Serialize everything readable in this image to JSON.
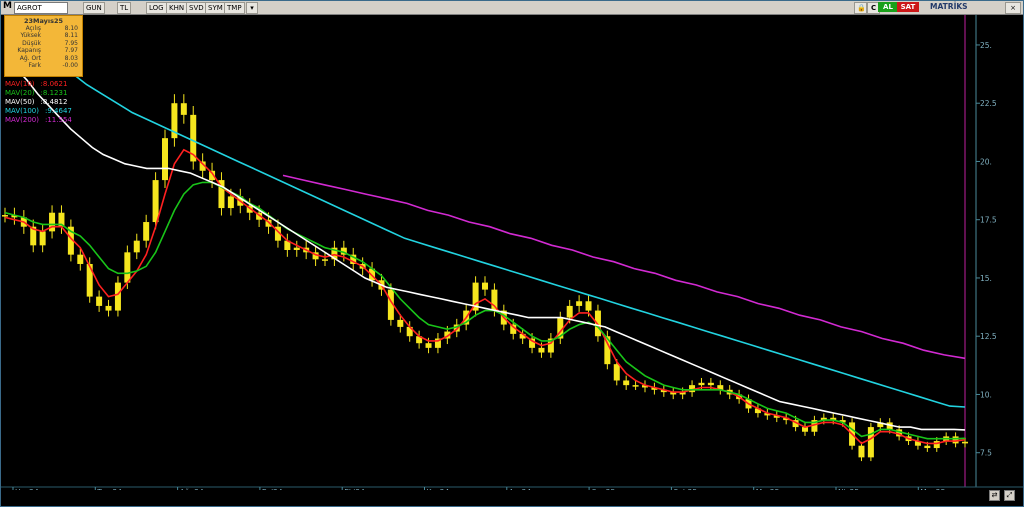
{
  "toolbar": {
    "logo": "M",
    "symbol": "AGROT",
    "items": [
      "GUN",
      "TL",
      "LOG",
      "KHN",
      "SVD",
      "SYM",
      "TMP"
    ],
    "buy_label": "AL",
    "sell_label": "SAT",
    "matrix_label": "MATRİKS",
    "c_label": "C",
    "lock_icon": "lock-icon",
    "close_icon": "close-icon"
  },
  "info_box": {
    "date": "23Mayıs25",
    "rows": [
      {
        "label": "Açılış",
        "value": "8.10"
      },
      {
        "label": "Yüksek",
        "value": "8.11"
      },
      {
        "label": "Düşük",
        "value": "7.95"
      },
      {
        "label": "Kapanış",
        "value": "7.97"
      },
      {
        "label": "Ağ. Ort",
        "value": "8.03"
      },
      {
        "label": "Fark",
        "value": "-0.00"
      }
    ]
  },
  "legend": [
    {
      "label": "MAV(10)",
      "value": ":8.0621",
      "color": "#ff2020"
    },
    {
      "label": "MAV(20)",
      "value": ":8.1231",
      "color": "#19c419"
    },
    {
      "label": "MAV(50)",
      "value": ":8.4812",
      "color": "#ffffff"
    },
    {
      "label": "MAV(100)",
      "value": ":9.4647",
      "color": "#22d3e0"
    },
    {
      "label": "MAV(200)",
      "value": ":11.554",
      "color": "#d22ad2"
    }
  ],
  "chart_data": {
    "type": "line",
    "subtype": "candlestick with moving averages",
    "title": "",
    "xlabel": "",
    "ylabel": "",
    "y_ticks": [
      "25.",
      "22.5",
      "20.",
      "17.5",
      "15.",
      "12.5",
      "10.",
      "7.5"
    ],
    "ylim": [
      6.2,
      26.2
    ],
    "x_ticks": [
      "Haz24",
      "Tem24",
      "Ağu24",
      "Eyl24",
      "Eki24",
      "Kas24",
      "Ara24",
      "Oca25",
      "Şub25",
      "Mar25",
      "Nis25",
      "May25"
    ],
    "candle_color": "#f6e61e",
    "grid": false,
    "price_close": [
      17.7,
      17.6,
      17.2,
      16.4,
      17.0,
      17.8,
      17.2,
      16.0,
      15.6,
      14.2,
      13.8,
      13.6,
      14.8,
      16.1,
      16.6,
      17.4,
      19.2,
      21.0,
      22.5,
      22.0,
      20.0,
      19.6,
      19.2,
      18.0,
      18.5,
      18.1,
      17.8,
      17.5,
      17.2,
      16.6,
      16.2,
      16.3,
      16.1,
      15.8,
      15.8,
      16.3,
      16.0,
      15.6,
      15.4,
      14.9,
      14.5,
      13.2,
      12.9,
      12.5,
      12.2,
      12.0,
      12.4,
      12.7,
      13.0,
      13.6,
      14.8,
      14.5,
      13.6,
      13.0,
      12.6,
      12.4,
      12.0,
      11.8,
      12.4,
      13.3,
      13.8,
      14.0,
      13.6,
      12.5,
      11.3,
      10.6,
      10.4,
      10.4,
      10.3,
      10.2,
      10.1,
      10.0,
      10.1,
      10.4,
      10.5,
      10.4,
      10.2,
      10.0,
      9.8,
      9.4,
      9.2,
      9.1,
      9.0,
      8.9,
      8.6,
      8.4,
      8.9,
      9.0,
      8.9,
      8.8,
      7.8,
      7.3,
      8.6,
      8.8,
      8.5,
      8.2,
      8.0,
      7.8,
      7.7,
      8.0,
      8.2,
      7.9,
      7.97
    ],
    "series": [
      {
        "name": "MAV(10)",
        "color": "#ff2020",
        "values": [
          17.6,
          17.5,
          17.4,
          17.1,
          17.0,
          17.2,
          17.2,
          16.7,
          16.3,
          15.5,
          14.7,
          14.2,
          14.3,
          14.8,
          15.3,
          16.0,
          17.2,
          18.6,
          19.9,
          20.5,
          20.3,
          19.9,
          19.5,
          18.9,
          18.6,
          18.3,
          18.0,
          17.7,
          17.4,
          17.0,
          16.6,
          16.4,
          16.2,
          16.0,
          15.9,
          16.0,
          15.9,
          15.7,
          15.5,
          15.1,
          14.7,
          14.0,
          13.4,
          12.9,
          12.5,
          12.3,
          12.3,
          12.5,
          12.8,
          13.3,
          13.9,
          14.1,
          13.8,
          13.3,
          12.9,
          12.6,
          12.3,
          12.1,
          12.2,
          12.7,
          13.2,
          13.5,
          13.5,
          13.0,
          12.2,
          11.4,
          10.9,
          10.6,
          10.4,
          10.3,
          10.2,
          10.1,
          10.1,
          10.2,
          10.3,
          10.3,
          10.2,
          10.1,
          9.9,
          9.6,
          9.4,
          9.2,
          9.1,
          9.0,
          8.8,
          8.6,
          8.7,
          8.8,
          8.8,
          8.7,
          8.3,
          7.9,
          8.1,
          8.4,
          8.4,
          8.3,
          8.1,
          8.0,
          7.9,
          7.9,
          8.0,
          8.0,
          8.06
        ]
      },
      {
        "name": "MAV(20)",
        "color": "#19c419",
        "values": [
          17.8,
          17.7,
          17.6,
          17.4,
          17.3,
          17.3,
          17.3,
          17.0,
          16.8,
          16.4,
          15.9,
          15.4,
          15.2,
          15.2,
          15.3,
          15.5,
          16.1,
          17.0,
          17.9,
          18.6,
          19.0,
          19.1,
          19.1,
          18.9,
          18.7,
          18.5,
          18.2,
          18.0,
          17.7,
          17.4,
          17.1,
          16.9,
          16.7,
          16.5,
          16.3,
          16.2,
          16.1,
          15.9,
          15.7,
          15.4,
          15.1,
          14.6,
          14.1,
          13.7,
          13.3,
          13.0,
          12.9,
          12.8,
          12.9,
          13.1,
          13.4,
          13.6,
          13.6,
          13.4,
          13.1,
          12.8,
          12.5,
          12.3,
          12.3,
          12.5,
          12.8,
          13.0,
          13.1,
          12.9,
          12.4,
          11.9,
          11.4,
          11.1,
          10.8,
          10.6,
          10.4,
          10.3,
          10.2,
          10.2,
          10.2,
          10.2,
          10.2,
          10.1,
          10.0,
          9.8,
          9.6,
          9.4,
          9.3,
          9.2,
          9.0,
          8.8,
          8.8,
          8.9,
          8.9,
          8.8,
          8.5,
          8.2,
          8.3,
          8.5,
          8.5,
          8.4,
          8.3,
          8.2,
          8.1,
          8.1,
          8.1,
          8.1,
          8.12
        ]
      },
      {
        "name": "MAV(50)",
        "color": "#ffffff",
        "values": [
          24.5,
          24.0,
          23.5,
          22.9,
          22.4,
          21.9,
          21.4,
          21.0,
          20.6,
          20.3,
          20.1,
          19.9,
          19.8,
          19.7,
          19.7,
          19.7,
          19.6,
          19.5,
          19.3,
          19.1,
          18.9,
          18.6,
          18.3,
          18.0,
          17.7,
          17.4,
          17.1,
          16.8,
          16.5,
          16.2,
          15.9,
          15.6,
          15.3,
          15.0,
          14.8,
          14.6,
          14.5,
          14.4,
          14.3,
          14.2,
          14.1,
          14.0,
          13.9,
          13.8,
          13.7,
          13.6,
          13.5,
          13.4,
          13.3,
          13.3,
          13.3,
          13.3,
          13.2,
          13.1,
          13.0,
          12.9,
          12.7,
          12.5,
          12.3,
          12.1,
          11.9,
          11.7,
          11.5,
          11.3,
          11.1,
          10.9,
          10.7,
          10.5,
          10.3,
          10.1,
          9.9,
          9.7,
          9.6,
          9.5,
          9.4,
          9.3,
          9.2,
          9.1,
          9.0,
          8.9,
          8.8,
          8.7,
          8.6,
          8.6,
          8.5,
          8.5,
          8.5,
          8.5,
          8.48
        ]
      },
      {
        "name": "MAV(100)",
        "color": "#22d3e0",
        "values": [
          25.5,
          25.1,
          24.6,
          24.2,
          23.8,
          23.3,
          22.9,
          22.5,
          22.1,
          21.8,
          21.5,
          21.2,
          20.9,
          20.6,
          20.3,
          20.0,
          19.7,
          19.4,
          19.1,
          18.8,
          18.5,
          18.2,
          17.9,
          17.6,
          17.3,
          17.0,
          16.7,
          16.5,
          16.3,
          16.1,
          15.9,
          15.7,
          15.5,
          15.3,
          15.1,
          14.9,
          14.7,
          14.5,
          14.3,
          14.1,
          13.9,
          13.7,
          13.5,
          13.3,
          13.1,
          12.9,
          12.7,
          12.5,
          12.3,
          12.1,
          11.9,
          11.7,
          11.5,
          11.3,
          11.1,
          10.9,
          10.7,
          10.5,
          10.3,
          10.1,
          9.9,
          9.7,
          9.5,
          9.46
        ]
      },
      {
        "name": "MAV(200)",
        "color": "#d22ad2",
        "values": [
          19.4,
          19.2,
          19.0,
          18.8,
          18.6,
          18.4,
          18.2,
          17.9,
          17.7,
          17.4,
          17.2,
          16.9,
          16.7,
          16.4,
          16.2,
          15.9,
          15.7,
          15.4,
          15.2,
          14.9,
          14.7,
          14.4,
          14.2,
          13.9,
          13.7,
          13.4,
          13.2,
          12.9,
          12.7,
          12.4,
          12.2,
          11.9,
          11.7,
          11.55
        ]
      }
    ]
  }
}
